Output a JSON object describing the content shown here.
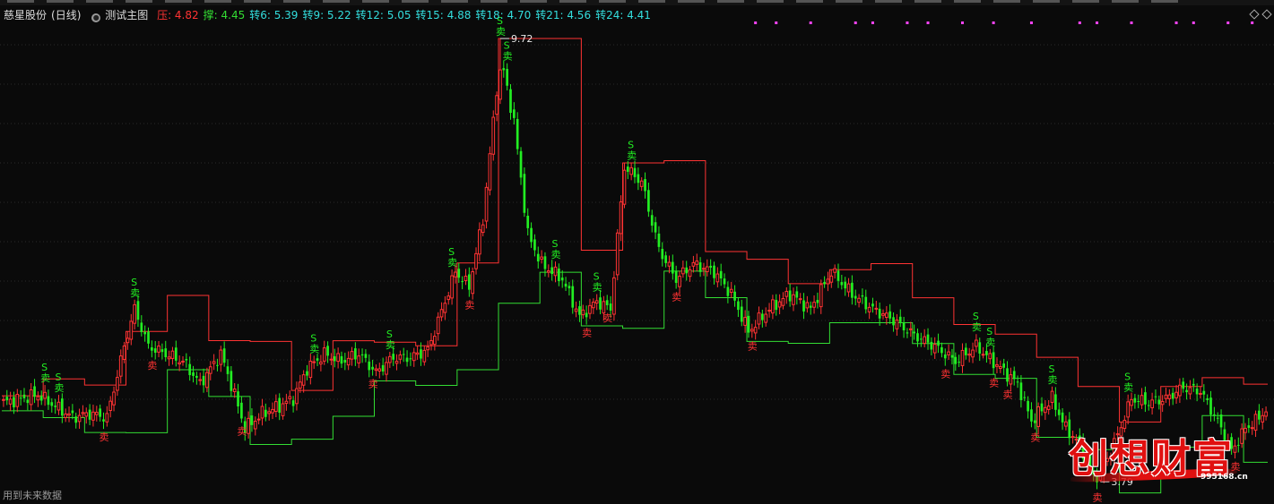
{
  "header": {
    "stock_name": "慈星股份",
    "period": "(日线)",
    "indicator_name": "测试主图",
    "values": [
      {
        "label": "压",
        "value": "4.82",
        "color": "red"
      },
      {
        "label": "撑",
        "value": "4.45",
        "color": "green"
      },
      {
        "label": "转6",
        "value": "5.39",
        "color": "cyan"
      },
      {
        "label": "转9",
        "value": "5.22",
        "color": "cyan"
      },
      {
        "label": "转12",
        "value": "5.05",
        "color": "cyan"
      },
      {
        "label": "转15",
        "value": "4.88",
        "color": "cyan"
      },
      {
        "label": "转18",
        "value": "4.70",
        "color": "cyan"
      },
      {
        "label": "转21",
        "value": "4.56",
        "color": "cyan"
      },
      {
        "label": "转24",
        "value": "4.41",
        "color": "cyan"
      }
    ]
  },
  "footer_note": "用到未来数据",
  "watermark": {
    "text": "创想财富",
    "url": "995168.cn"
  },
  "colors": {
    "background": "#0a0a0a",
    "up": "#ff3333",
    "down": "#22ee22",
    "resistance": "#ff3333",
    "support": "#33dd33",
    "marker": "#ff44ff",
    "grid": "#2a2a2a"
  },
  "chart_data": {
    "type": "candlestick",
    "ylim": [
      3.6,
      9.9
    ],
    "grid": "horizontal-dotted",
    "high_annotation": {
      "index": 144,
      "label": "9.72",
      "value": 9.72
    },
    "low_annotation": {
      "index": 318,
      "label": "3.79",
      "value": 3.79
    },
    "signal_labels": {
      "buy": "S",
      "sell": "卖"
    },
    "anchors": [
      [
        0,
        4.85
      ],
      [
        10,
        4.95
      ],
      [
        20,
        4.65
      ],
      [
        25,
        4.7
      ],
      [
        30,
        4.65
      ],
      [
        35,
        5.6
      ],
      [
        38,
        6.1
      ],
      [
        42,
        5.6
      ],
      [
        47,
        5.5
      ],
      [
        52,
        5.4
      ],
      [
        57,
        5.1
      ],
      [
        63,
        5.5
      ],
      [
        67,
        4.95
      ],
      [
        70,
        4.5
      ],
      [
        75,
        4.7
      ],
      [
        80,
        4.8
      ],
      [
        84,
        4.9
      ],
      [
        88,
        5.3
      ],
      [
        93,
        5.5
      ],
      [
        98,
        5.4
      ],
      [
        103,
        5.5
      ],
      [
        108,
        5.25
      ],
      [
        113,
        5.45
      ],
      [
        118,
        5.45
      ],
      [
        123,
        5.55
      ],
      [
        128,
        6.2
      ],
      [
        131,
        6.6
      ],
      [
        135,
        6.4
      ],
      [
        139,
        7.3
      ],
      [
        142,
        8.6
      ],
      [
        144,
        9.5
      ],
      [
        148,
        8.6
      ],
      [
        152,
        7.1
      ],
      [
        156,
        6.7
      ],
      [
        162,
        6.5
      ],
      [
        167,
        6.0
      ],
      [
        172,
        6.2
      ],
      [
        176,
        6.1
      ],
      [
        180,
        8.0
      ],
      [
        185,
        7.8
      ],
      [
        190,
        6.9
      ],
      [
        195,
        6.5
      ],
      [
        200,
        6.7
      ],
      [
        206,
        6.6
      ],
      [
        211,
        6.3
      ],
      [
        216,
        5.8
      ],
      [
        222,
        6.1
      ],
      [
        228,
        6.3
      ],
      [
        234,
        6.1
      ],
      [
        240,
        6.6
      ],
      [
        246,
        6.3
      ],
      [
        252,
        6.1
      ],
      [
        258,
        5.95
      ],
      [
        264,
        5.75
      ],
      [
        270,
        5.6
      ],
      [
        276,
        5.4
      ],
      [
        282,
        5.6
      ],
      [
        288,
        5.35
      ],
      [
        294,
        5.1
      ],
      [
        298,
        4.6
      ],
      [
        304,
        4.9
      ],
      [
        308,
        4.5
      ],
      [
        312,
        4.3
      ],
      [
        316,
        3.85
      ],
      [
        318,
        3.9
      ],
      [
        322,
        4.3
      ],
      [
        327,
        4.9
      ],
      [
        332,
        4.85
      ],
      [
        337,
        4.9
      ],
      [
        342,
        5.05
      ],
      [
        347,
        5.0
      ],
      [
        352,
        4.6
      ],
      [
        356,
        4.2
      ],
      [
        360,
        4.5
      ],
      [
        363,
        4.6
      ],
      [
        366,
        4.75
      ]
    ],
    "magenta_markers": [
      218,
      224,
      234,
      247,
      252,
      262,
      268,
      278,
      287,
      298,
      312,
      317,
      327,
      340,
      345,
      355,
      362
    ]
  }
}
